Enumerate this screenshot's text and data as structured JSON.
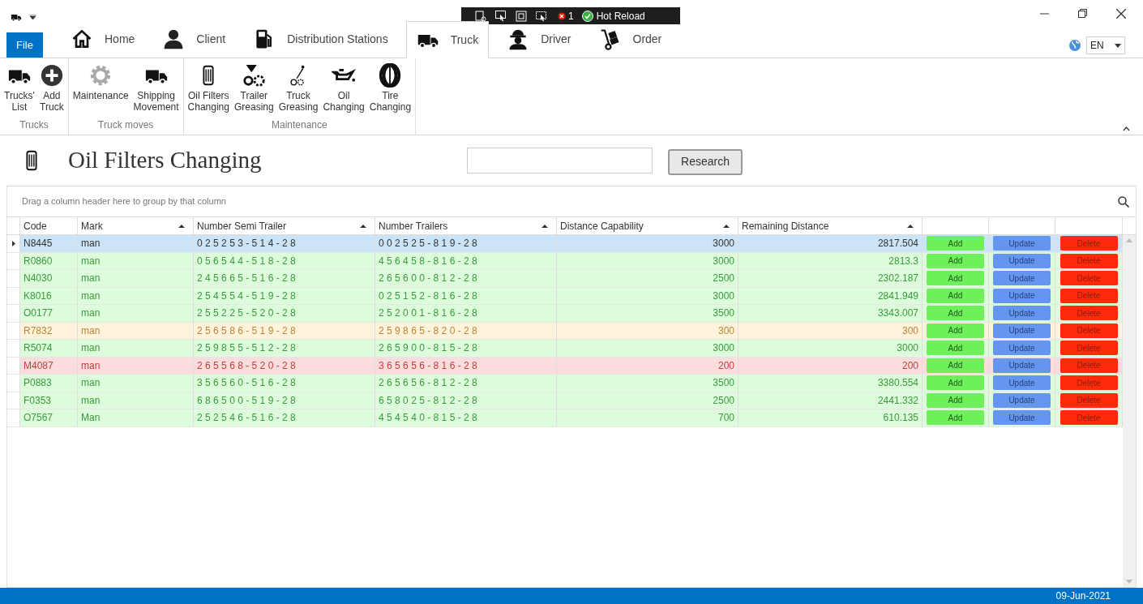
{
  "debug_toolbar": {
    "count": "1",
    "hot_reload": "Hot Reload"
  },
  "tabs": [
    {
      "label": "File",
      "kind": "file",
      "selected": false
    },
    {
      "label": "Home",
      "kind": "tab",
      "selected": false
    },
    {
      "label": "Client",
      "kind": "tab",
      "selected": false
    },
    {
      "label": "Distribution Stations",
      "kind": "tab",
      "selected": false
    },
    {
      "label": "Truck",
      "kind": "tab",
      "selected": true
    },
    {
      "label": "Driver",
      "kind": "tab",
      "selected": false
    },
    {
      "label": "Order",
      "kind": "tab",
      "selected": false
    }
  ],
  "language": {
    "value": "EN"
  },
  "ribbon": [
    {
      "title": "Trucks",
      "items": [
        "Trucks' List",
        "Add Truck"
      ]
    },
    {
      "title": "Truck moves",
      "items": [
        "Maintenance",
        "Shipping Movement"
      ]
    },
    {
      "title": "Maintenance",
      "items": [
        "Oil Filters Changing",
        "Trailer Greasing",
        "Truck Greasing",
        "Oil Changing",
        "Tire Changing"
      ]
    }
  ],
  "page": {
    "title": "Oil Filters Changing",
    "search_button": "Research"
  },
  "grid": {
    "group_panel": "Drag a column header here to group by that column",
    "columns": [
      {
        "label": "Code",
        "sorted": false
      },
      {
        "label": "Mark",
        "sorted": true
      },
      {
        "label": "Number Semi Trailer",
        "sorted": true
      },
      {
        "label": "Number Trailers",
        "sorted": true
      },
      {
        "label": "Distance Capability",
        "sorted": true
      },
      {
        "label": "Remaining Distance",
        "sorted": true
      }
    ],
    "rows": [
      {
        "selected": true,
        "cells": [
          "N8445",
          "man",
          "025253-514-28",
          "002525-819-28",
          "3000",
          "2817.504"
        ],
        "buttons": [
          "Add",
          "Update",
          "Delete"
        ]
      },
      {
        "selected": false,
        "color": "#dcfcdc",
        "cells": [
          "R0860",
          "man",
          "056544-518-28",
          "456458-816-28",
          "3000",
          "2813.3"
        ],
        "buttons": [
          "Add",
          "Update",
          "Delete"
        ]
      },
      {
        "selected": false,
        "color": "#dcfcdc",
        "cells": [
          "N4030",
          "man",
          "245665-516-28",
          "265600-812-28",
          "2500",
          "2302.187"
        ],
        "buttons": [
          "Add",
          "Update",
          "Delete"
        ]
      },
      {
        "selected": false,
        "color": "#dcfcdc",
        "cells": [
          "K8016",
          "man",
          "254554-519-28",
          "025152-816-28",
          "3000",
          "2841.949"
        ],
        "buttons": [
          "Add",
          "Update",
          "Delete"
        ]
      },
      {
        "selected": false,
        "color": "#dcfcdc",
        "cells": [
          "O0177",
          "man",
          "255225-520-28",
          "252001-816-28",
          "3500",
          "3343.007"
        ],
        "buttons": [
          "Add",
          "Update",
          "Delete"
        ]
      },
      {
        "selected": false,
        "color": "#fff3dc",
        "cells": [
          "R7832",
          "man",
          "256586-519-28",
          "259865-820-28",
          "300",
          "300"
        ],
        "buttons": [
          "Add",
          "Update",
          "Delete"
        ]
      },
      {
        "selected": false,
        "color": "#dcfcdc",
        "cells": [
          "R5074",
          "man",
          "259855-512-28",
          "265900-815-28",
          "3000",
          "3000"
        ],
        "buttons": [
          "Add",
          "Update",
          "Delete"
        ]
      },
      {
        "selected": false,
        "color": "#fcdcdc",
        "cells": [
          "M4087",
          "man",
          "265568-520-28",
          "365656-816-28",
          "200",
          "200"
        ],
        "buttons": [
          "Add",
          "Update",
          "Delete"
        ]
      },
      {
        "selected": false,
        "color": "#dcfcdc",
        "cells": [
          "P0883",
          "man",
          "356560-516-28",
          "265656-812-28",
          "3500",
          "3380.554"
        ],
        "buttons": [
          "Add",
          "Update",
          "Delete"
        ]
      },
      {
        "selected": false,
        "color": "#dcfcdc",
        "cells": [
          "F0353",
          "man",
          "686500-519-28",
          "658025-812-28",
          "2500",
          "2441.332"
        ],
        "buttons": [
          "Add",
          "Update",
          "Delete"
        ]
      },
      {
        "selected": false,
        "color": "#dcfcdc",
        "cells": [
          "O7567",
          "Man",
          "252546-516-28",
          "454540-815-28",
          "700",
          "610.135"
        ],
        "buttons": [
          "Add",
          "Update",
          "Delete"
        ]
      }
    ]
  },
  "status_bar": {
    "date": "09-Jun-2021"
  }
}
